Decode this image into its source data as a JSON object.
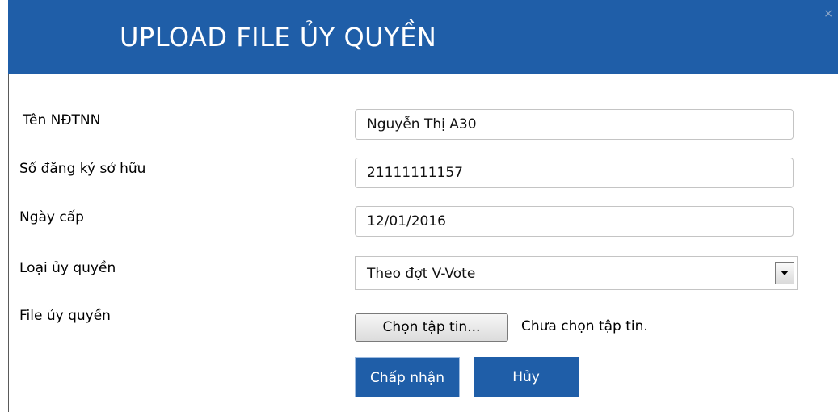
{
  "dialog": {
    "title": "UPLOAD FILE ỦY QUYỀN",
    "close_symbol": "×"
  },
  "form": {
    "fields": [
      {
        "label": "Tên NĐTNN",
        "value": "Nguyễn Thị A30"
      },
      {
        "label": "Số đăng ký sở hữu",
        "value": "21111111157"
      },
      {
        "label": "Ngày cấp",
        "value": "12/01/2016"
      },
      {
        "label": "Loại ủy quyền",
        "value": "Theo đợt V-Vote"
      },
      {
        "label": "File ủy quyền"
      }
    ],
    "file_button_label": "Chọn tập tin...",
    "file_status": "Chưa chọn tập tin."
  },
  "actions": {
    "accept_label": "Chấp nhận",
    "cancel_label": "Hủy"
  },
  "colors": {
    "header_bg": "#1f5ea8",
    "button_bg": "#1f5ea8"
  },
  "icons": [
    "close-icon",
    "dropdown-arrow-icon"
  ]
}
